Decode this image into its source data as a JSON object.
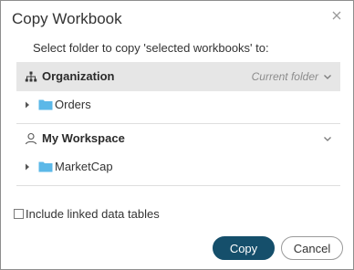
{
  "dialog": {
    "title": "Copy Workbook",
    "subtitle": "Select folder to copy 'selected workbooks' to:"
  },
  "sections": [
    {
      "label": "Organization",
      "current_label": "Current folder",
      "icon": "organization-icon",
      "folders": [
        {
          "label": "Orders",
          "icon": "folder-icon"
        }
      ]
    },
    {
      "label": "My Workspace",
      "icon": "user-icon",
      "folders": [
        {
          "label": "MarketCap",
          "icon": "folder-icon"
        }
      ]
    }
  ],
  "options": {
    "include_linked_label": "Include linked data tables",
    "include_linked_checked": false
  },
  "buttons": {
    "copy_label": "Copy",
    "cancel_label": "Cancel"
  },
  "colors": {
    "primary": "#154f6b",
    "folder": "#5bb8e8",
    "selected_row_bg": "#e6e6e6"
  }
}
